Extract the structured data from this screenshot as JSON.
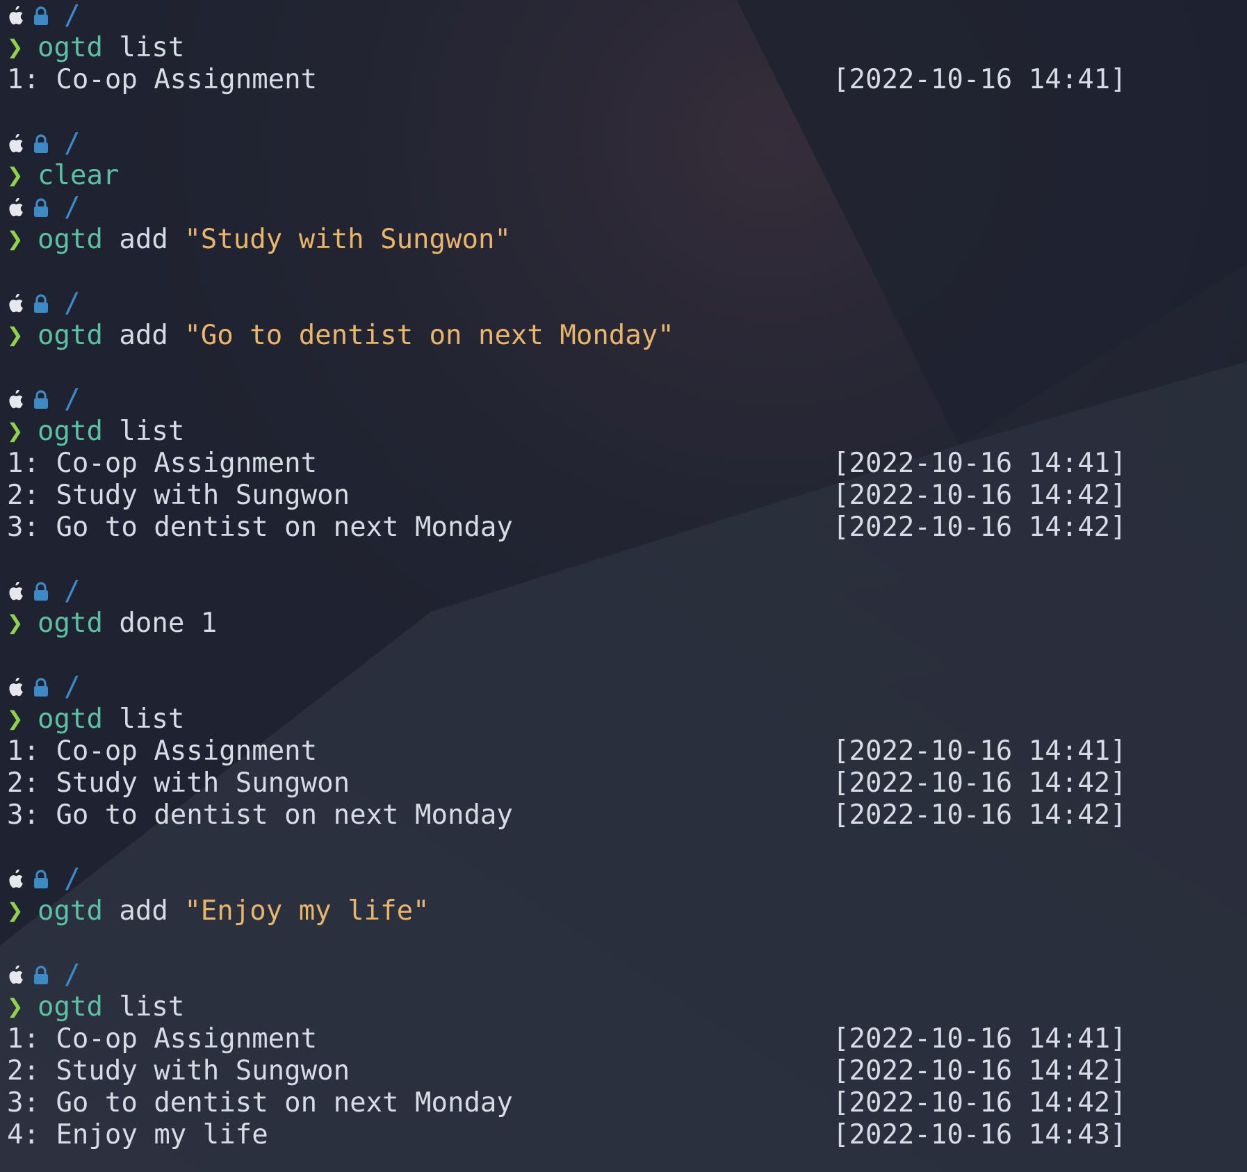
{
  "prompt": {
    "apple_icon": "apple-icon",
    "lock_icon": "lock-icon",
    "path": "/",
    "arrow": "❯"
  },
  "session": [
    {
      "type": "prompt"
    },
    {
      "type": "cmd",
      "name": "ogtd",
      "args": " list",
      "str": ""
    },
    {
      "type": "item",
      "text": "1: Co-op Assignment",
      "ts": "[2022-10-16 14:41]"
    },
    {
      "type": "blank"
    },
    {
      "type": "prompt"
    },
    {
      "type": "cmd",
      "name": "clear",
      "args": "",
      "str": ""
    },
    {
      "type": "prompt"
    },
    {
      "type": "cmd",
      "name": "ogtd",
      "args": " add ",
      "str": "\"Study with Sungwon\""
    },
    {
      "type": "blank"
    },
    {
      "type": "prompt"
    },
    {
      "type": "cmd",
      "name": "ogtd",
      "args": " add ",
      "str": "\"Go to dentist on next Monday\""
    },
    {
      "type": "blank"
    },
    {
      "type": "prompt"
    },
    {
      "type": "cmd",
      "name": "ogtd",
      "args": " list",
      "str": ""
    },
    {
      "type": "item",
      "text": "1: Co-op Assignment",
      "ts": "[2022-10-16 14:41]"
    },
    {
      "type": "item",
      "text": "2: Study with Sungwon",
      "ts": "[2022-10-16 14:42]"
    },
    {
      "type": "item",
      "text": "3: Go to dentist on next Monday",
      "ts": "[2022-10-16 14:42]"
    },
    {
      "type": "blank"
    },
    {
      "type": "prompt"
    },
    {
      "type": "cmd",
      "name": "ogtd",
      "args": " done 1",
      "str": ""
    },
    {
      "type": "blank"
    },
    {
      "type": "prompt"
    },
    {
      "type": "cmd",
      "name": "ogtd",
      "args": " list",
      "str": ""
    },
    {
      "type": "item",
      "text": "1: Co-op Assignment",
      "ts": "[2022-10-16 14:41]"
    },
    {
      "type": "item",
      "text": "2: Study with Sungwon",
      "ts": "[2022-10-16 14:42]"
    },
    {
      "type": "item",
      "text": "3: Go to dentist on next Monday",
      "ts": "[2022-10-16 14:42]"
    },
    {
      "type": "blank"
    },
    {
      "type": "prompt"
    },
    {
      "type": "cmd",
      "name": "ogtd",
      "args": " add ",
      "str": "\"Enjoy my life\""
    },
    {
      "type": "blank"
    },
    {
      "type": "prompt"
    },
    {
      "type": "cmd",
      "name": "ogtd",
      "args": " list",
      "str": ""
    },
    {
      "type": "item",
      "text": "1: Co-op Assignment",
      "ts": "[2022-10-16 14:41]"
    },
    {
      "type": "item",
      "text": "2: Study with Sungwon",
      "ts": "[2022-10-16 14:42]"
    },
    {
      "type": "item",
      "text": "3: Go to dentist on next Monday",
      "ts": "[2022-10-16 14:42]"
    },
    {
      "type": "item",
      "text": "4: Enjoy my life",
      "ts": "[2022-10-16 14:43]"
    }
  ],
  "colors": {
    "background": "#222634",
    "arrow": "#8ed34a",
    "command": "#5cc0a3",
    "string": "#e8b66a",
    "path": "#3c8bc7",
    "text": "#d7dbe4"
  }
}
